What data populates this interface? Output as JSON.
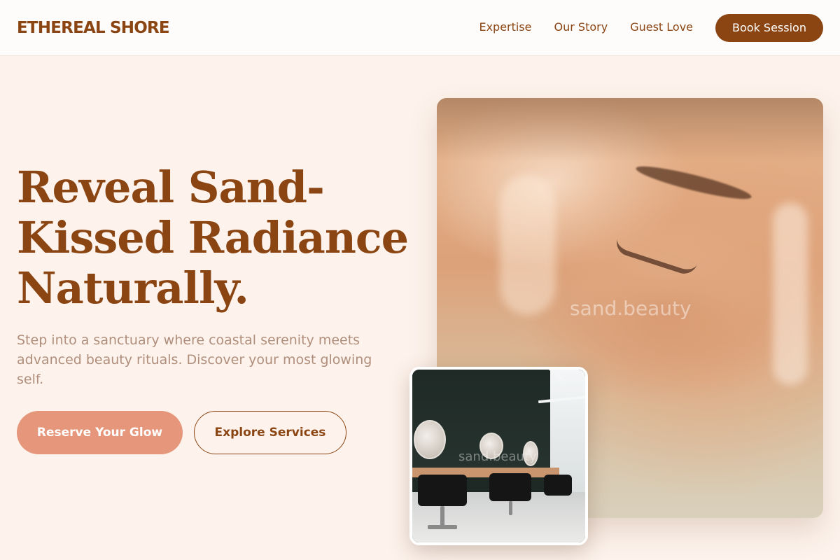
{
  "header": {
    "logo": "ETHEREAL SHORE",
    "nav": [
      "Expertise",
      "Our Story",
      "Guest Love"
    ],
    "cta": "Book Session"
  },
  "hero": {
    "headline_lines": [
      "Reveal Sand-",
      "Kissed Radiance",
      "Naturally."
    ],
    "subtext": "Step into a sanctuary where coastal serenity meets advanced beauty rituals. Discover your most glowing self.",
    "primary_button": "Reserve Your Glow",
    "secondary_button": "Explore Services"
  },
  "images": {
    "main_watermark": "sand.beauty",
    "salon_watermark": "sand.beauty"
  },
  "colors": {
    "brand_brown": "#8b4513",
    "accent_coral": "#e6967a",
    "background_sand": "#fdf3ec",
    "subtext_muted": "#b08e7c"
  }
}
